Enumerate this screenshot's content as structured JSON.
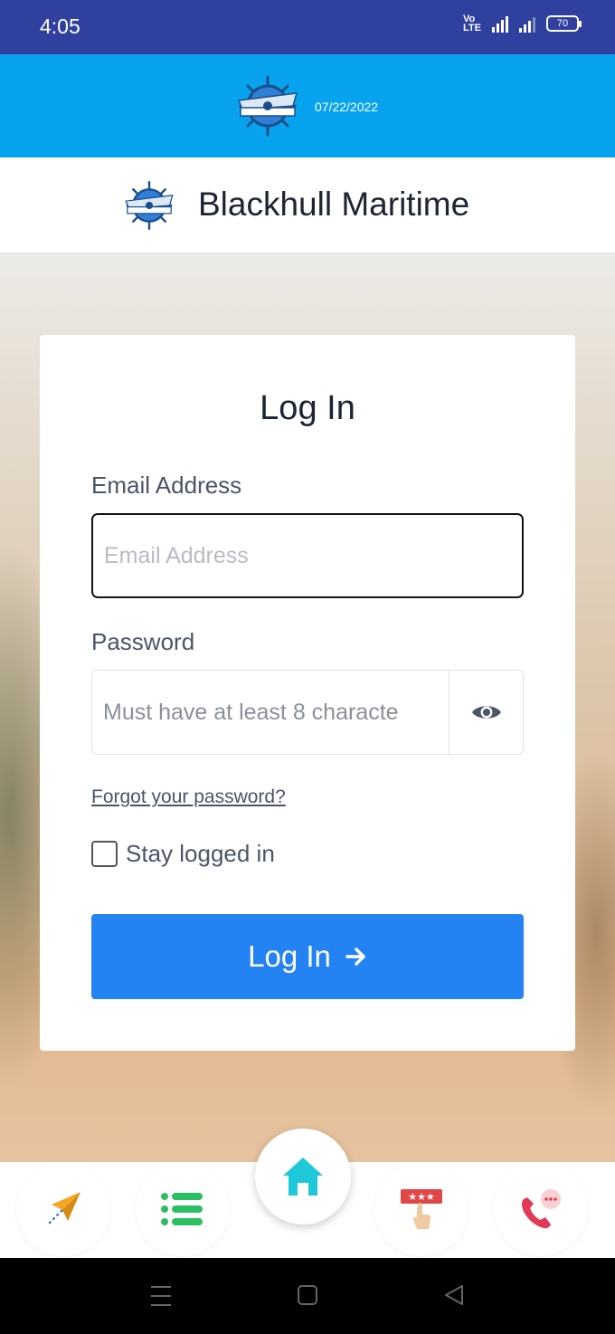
{
  "status_bar": {
    "time": "4:05",
    "network_label": "VoLTE",
    "battery": "70"
  },
  "banner": {
    "date": "07/22/2022"
  },
  "header": {
    "title": "Blackhull Maritime"
  },
  "login": {
    "title": "Log In",
    "email_label": "Email Address",
    "email_placeholder": "Email Address",
    "password_label": "Password",
    "password_placeholder": "Must have at least 8 characte",
    "forgot_link": "Forgot your password?",
    "stay_logged_in": "Stay logged in",
    "submit_label": "Log In"
  },
  "bottom_nav": [
    {
      "icon": "paper-plane-icon"
    },
    {
      "icon": "list-icon"
    },
    {
      "icon": "home-icon"
    },
    {
      "icon": "rating-icon"
    },
    {
      "icon": "phone-chat-icon"
    }
  ],
  "colors": {
    "status_bar": "#30409e",
    "banner": "#07a3ee",
    "primary_button": "#2483f3",
    "home_icon": "#1fc8d8"
  }
}
